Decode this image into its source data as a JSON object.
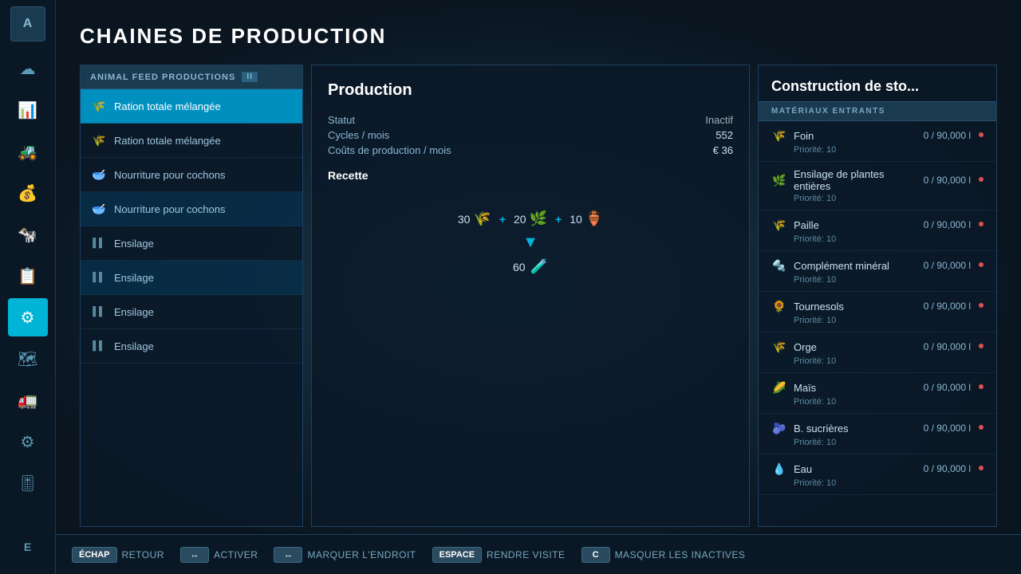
{
  "page": {
    "title": "CHAINES DE PRODUCTION"
  },
  "sidebar": {
    "items": [
      {
        "id": "logo",
        "label": "A",
        "icon": "A",
        "active": false
      },
      {
        "id": "weather",
        "label": "Météo",
        "icon": "☁",
        "active": false
      },
      {
        "id": "stats",
        "label": "Statistiques",
        "icon": "📊",
        "active": false
      },
      {
        "id": "tractor",
        "label": "Véhicules",
        "icon": "🚜",
        "active": false
      },
      {
        "id": "money",
        "label": "Finances",
        "icon": "💰",
        "active": false
      },
      {
        "id": "animals",
        "label": "Animaux",
        "icon": "🐄",
        "active": false
      },
      {
        "id": "contracts",
        "label": "Contrats",
        "icon": "📋",
        "active": false
      },
      {
        "id": "production",
        "label": "Production",
        "icon": "⚙",
        "active": true
      },
      {
        "id": "map",
        "label": "Carte",
        "icon": "🗺",
        "active": false
      },
      {
        "id": "machine2",
        "label": "Machines",
        "icon": "🚛",
        "active": false
      },
      {
        "id": "settings",
        "label": "Paramètres",
        "icon": "⚙",
        "active": false
      },
      {
        "id": "sliders",
        "label": "Réglages",
        "icon": "🎚",
        "active": false
      },
      {
        "id": "e",
        "label": "E",
        "icon": "E",
        "active": false
      }
    ]
  },
  "list_panel": {
    "header_name": "ANIMAL FEED PRODUCTIONS",
    "header_badge": "II",
    "items": [
      {
        "id": "r1",
        "label": "Ration totale mélangée",
        "icon": "🌾",
        "active": true,
        "secondary": false
      },
      {
        "id": "r2",
        "label": "Ration totale mélangée",
        "icon": "🌾",
        "active": false,
        "secondary": true
      },
      {
        "id": "r3",
        "label": "Nourriture pour cochons",
        "icon": "🥣",
        "active": false,
        "secondary": false
      },
      {
        "id": "r4",
        "label": "Nourriture pour cochons",
        "icon": "🥣",
        "active": false,
        "secondary": true
      },
      {
        "id": "e1",
        "label": "Ensilage",
        "icon": "▌▌",
        "active": false,
        "secondary": false
      },
      {
        "id": "e2",
        "label": "Ensilage",
        "icon": "▌▌",
        "active": false,
        "secondary": true
      },
      {
        "id": "e3",
        "label": "Ensilage",
        "icon": "▌▌",
        "active": false,
        "secondary": false
      },
      {
        "id": "e4",
        "label": "Ensilage",
        "icon": "▌▌",
        "active": false,
        "secondary": false
      }
    ]
  },
  "production_panel": {
    "title": "Production",
    "statut_label": "Statut",
    "statut_value": "Inactif",
    "cycles_label": "Cycles / mois",
    "cycles_value": "552",
    "couts_label": "Coûts de production / mois",
    "couts_value": "€ 36",
    "recette_label": "Recette",
    "recipe": {
      "input1_qty": "30",
      "input1_icon": "🌾",
      "input2_qty": "20",
      "input2_icon": "🌿",
      "input3_qty": "10",
      "input3_icon": "🏺",
      "output_qty": "60",
      "output_icon": "🧪"
    }
  },
  "materials_panel": {
    "title": "Construction de sto...",
    "section_header": "MATÉRIAUX ENTRANTS",
    "materials": [
      {
        "name": "Foin",
        "amount": "0 / 90,000 l",
        "priority": "Priorité: 10",
        "icon": "🌾"
      },
      {
        "name": "Ensilage de plantes entières",
        "amount": "0 / 90,000 l",
        "priority": "Priorité: 10",
        "icon": "🌿"
      },
      {
        "name": "Paille",
        "amount": "0 / 90,000 l",
        "priority": "Priorité: 10",
        "icon": "🌾"
      },
      {
        "name": "Complément minéral",
        "amount": "0 / 90,000 l",
        "priority": "Priorité: 10",
        "icon": "🔩"
      },
      {
        "name": "Tournesols",
        "amount": "0 / 90,000 l",
        "priority": "Priorité: 10",
        "icon": "🌻"
      },
      {
        "name": "Orge",
        "amount": "0 / 90,000 l",
        "priority": "Priorité: 10",
        "icon": "🌾"
      },
      {
        "name": "Maïs",
        "amount": "0 / 90,000 l",
        "priority": "Priorité: 10",
        "icon": "🌽"
      },
      {
        "name": "B. sucrières",
        "amount": "0 / 90,000 l",
        "priority": "Priorité: 10",
        "icon": "🫐"
      },
      {
        "name": "Eau",
        "amount": "0 / 90,000 l",
        "priority": "Priorité: 10",
        "icon": "💧"
      }
    ]
  },
  "bottom_bar": {
    "actions": [
      {
        "key": "ÉCHAP",
        "label": "RETOUR"
      },
      {
        "key": "↔",
        "label": "ACTIVER"
      },
      {
        "key": "↔",
        "label": "MARQUER L'ENDROIT"
      },
      {
        "key": "ESPACE",
        "label": "RENDRE VISITE"
      },
      {
        "key": "C",
        "label": "MASQUER LES INACTIVES"
      }
    ]
  }
}
